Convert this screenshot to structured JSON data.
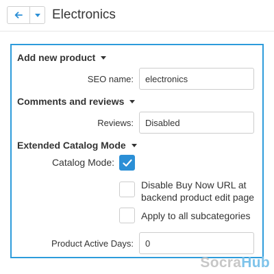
{
  "header": {
    "title": "Electronics",
    "back_icon": "arrow-left-icon",
    "dropdown_icon": "caret-down-icon"
  },
  "sections": {
    "add_new_product": {
      "title": "Add new product",
      "seo_name_label": "SEO name:",
      "seo_name_value": "electronics"
    },
    "comments_reviews": {
      "title": "Comments and reviews",
      "reviews_label": "Reviews:",
      "reviews_value": "Disabled"
    },
    "extended_catalog": {
      "title": "Extended Catalog Mode",
      "catalog_mode_label": "Catalog Mode:",
      "catalog_mode_checked": true,
      "disable_buy_now_label_line1": "Disable Buy Now URL at",
      "disable_buy_now_label_line2": "backend product edit page",
      "disable_buy_now_checked": false,
      "apply_subcategories_label": "Apply to all subcategories",
      "apply_subcategories_checked": false,
      "active_days_label": "Product Active Days:",
      "active_days_value": "0"
    }
  },
  "watermark": {
    "part1": "Socra",
    "part2": "Hub"
  },
  "colors": {
    "accent": "#2c9bdb",
    "checkbox_checked": "#2b8fd6",
    "nav_icon": "#2b8fd6"
  }
}
